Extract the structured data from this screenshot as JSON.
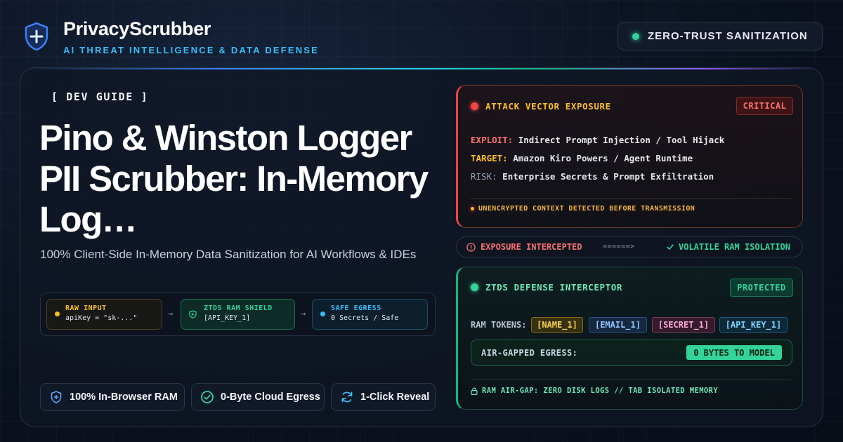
{
  "brand": {
    "name": "PrivacyScrubber",
    "tagline": "AI THREAT INTELLIGENCE & DATA DEFENSE",
    "badge": "ZERO-TRUST SANITIZATION"
  },
  "hero": {
    "eyebrow": "[ DEV GUIDE ]",
    "title": "Pino & Winston Logger PII Scrubber: In-Memory Log…",
    "subtitle": "100% Client-Side In-Memory Data Sanitization for AI Workflows & IDEs"
  },
  "flow": [
    {
      "label": "RAW INPUT",
      "value": "apiKey = \"sk-...\"",
      "color": "#fbbf24"
    },
    {
      "label": "ZTDS RAM SHIELD",
      "value": "[API_KEY_1]",
      "color": "#34d399"
    },
    {
      "label": "SAFE EGRESS",
      "value": "0 Secrets / Safe",
      "color": "#38bdf8"
    }
  ],
  "flow_arrow": "→",
  "features": [
    {
      "label": "100% In-Browser RAM",
      "icon": "shield-plus-icon"
    },
    {
      "label": "0-Byte Cloud Egress",
      "icon": "check-circle-icon"
    },
    {
      "label": "1-Click Reveal",
      "icon": "refresh-icon"
    }
  ],
  "attack": {
    "title": "ATTACK VECTOR EXPOSURE",
    "badge": "CRITICAL",
    "rows": [
      {
        "key": "EXPLOIT:",
        "value": "Indirect Prompt Injection / Tool Hijack",
        "color": "#f87171"
      },
      {
        "key": "TARGET:",
        "value": "Amazon Kiro Powers / Agent Runtime",
        "color": "#fbbf24"
      },
      {
        "key": "RISK:",
        "value": "Enterprise Secrets & Prompt Exfiltration",
        "color": "#94a3b8"
      }
    ],
    "footer": "UNENCRYPTED CONTEXT DETECTED BEFORE TRANSMISSION"
  },
  "intercept": {
    "left": "EXPOSURE INTERCEPTED",
    "middle": "======>",
    "right": "VOLATILE RAM ISOLATION"
  },
  "defense": {
    "title": "ZTDS DEFENSE INTERCEPTOR",
    "badge": "PROTECTED",
    "tokens_label": "RAM TOKENS:",
    "tokens": [
      "[NAME_1]",
      "[EMAIL_1]",
      "[SECRET_1]",
      "[API_KEY_1]"
    ],
    "egress_label": "AIR-GAPPED EGRESS:",
    "egress_value": "0 BYTES TO MODEL",
    "footer": "RAM AIR-GAP: ZERO DISK LOGS // TAB ISOLATED MEMORY"
  },
  "colors": {
    "accent_blue": "#38bdf8",
    "safe_green": "#34d399",
    "danger_red": "#ef4444",
    "warn_amber": "#fbbf24"
  }
}
